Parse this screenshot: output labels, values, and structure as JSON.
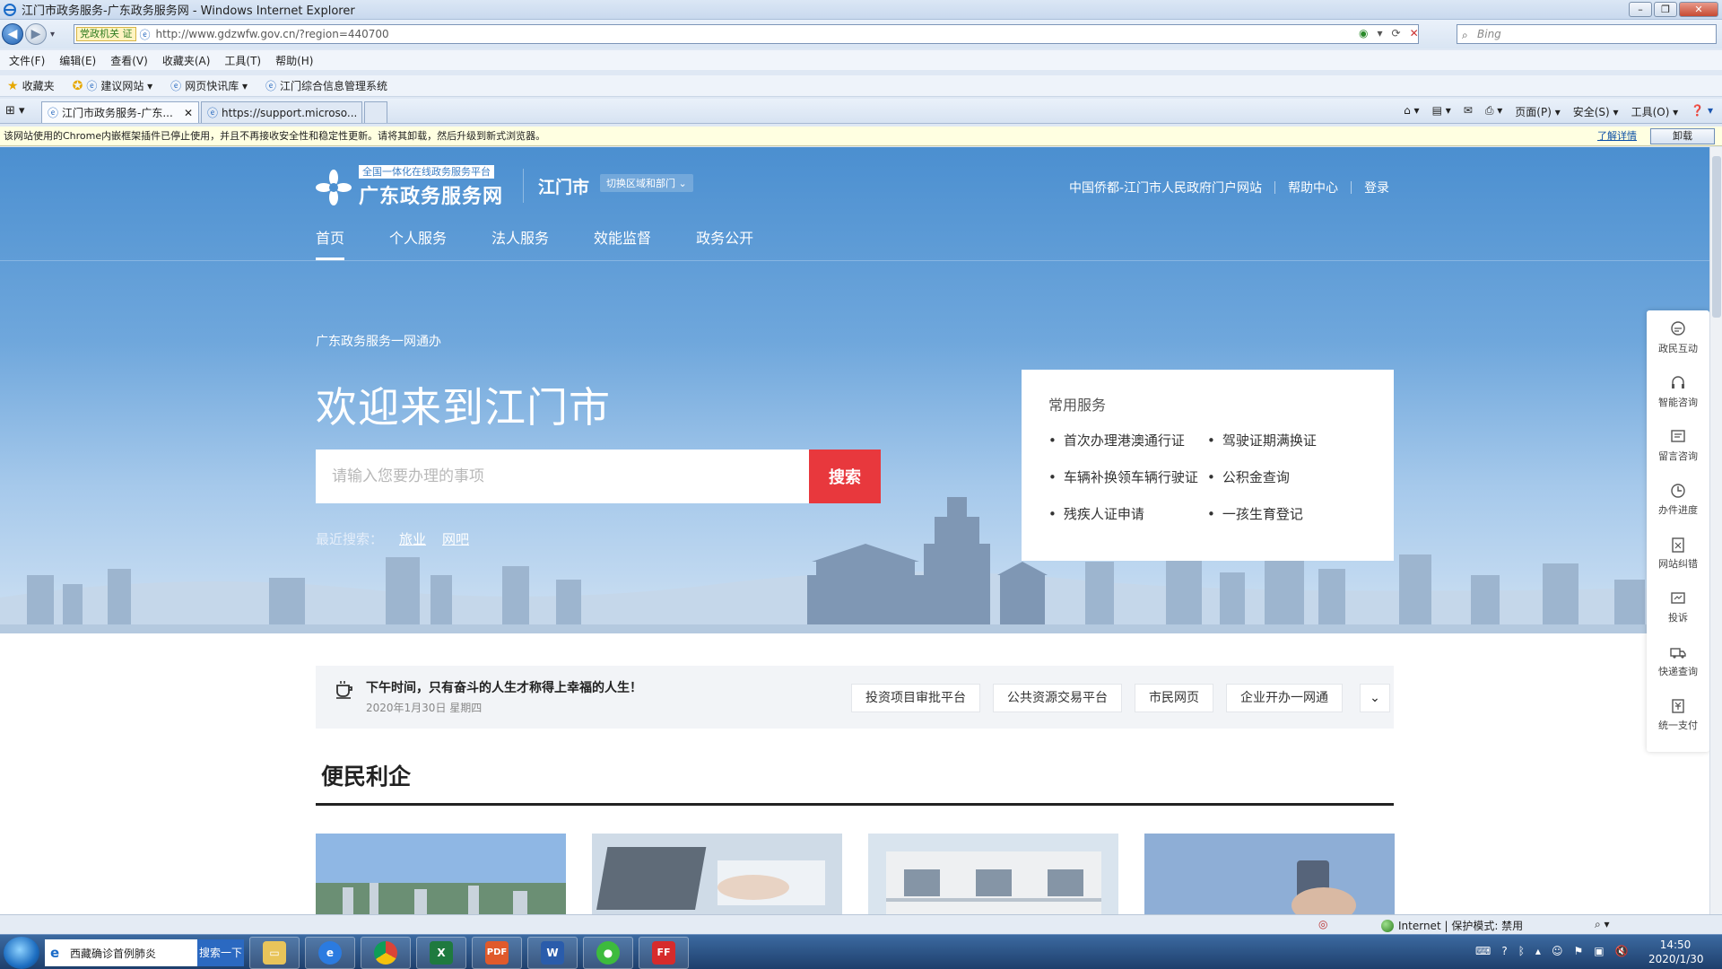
{
  "window": {
    "title": "江门市政务服务-广东政务服务网 - Windows Internet Explorer",
    "address": "http://www.gdzwfw.gov.cn/?region=440700",
    "address_badge": "党政机关 证",
    "search_placeholder": "Bing"
  },
  "menu": [
    "文件(F)",
    "编辑(E)",
    "查看(V)",
    "收藏夹(A)",
    "工具(T)",
    "帮助(H)"
  ],
  "favorites": {
    "label": "收藏夹",
    "items": [
      "建议网站 ▾",
      "网页快讯库 ▾",
      "江门综合信息管理系统"
    ]
  },
  "tabs": [
    {
      "label": "江门市政务服务-广东..."
    },
    {
      "label": "https://support.microso..."
    }
  ],
  "toolbar_tools": [
    "页面(P) ▾",
    "安全(S) ▾",
    "工具(O) ▾"
  ],
  "infobar": {
    "message": "该网站使用的Chrome内嵌框架插件已停止使用，并且不再接收安全性和稳定性更新。请将其卸载，然后升级到新式浏览器。",
    "more": "了解详情",
    "uninstall": "卸载"
  },
  "site": {
    "logo_tag": "全国一体化在线政务服务平台",
    "logo_name": "广东政务服务网",
    "city": "江门市",
    "switch_label": "切换区域和部门 ⌄",
    "top_links": [
      "中国侨都-江门市人民政府门户网站",
      "帮助中心",
      "登录"
    ],
    "nav": [
      "首页",
      "个人服务",
      "法人服务",
      "效能监督",
      "政务公开"
    ],
    "slogan": "广东政务服务一网通办",
    "welcome": "欢迎来到江门市",
    "search_placeholder": "请输入您要办理的事项",
    "search_button": "搜索",
    "recent_label": "最近搜索：",
    "recent_items": [
      "旅业",
      "网吧"
    ],
    "common_title": "常用服务",
    "common_items": [
      "首次办理港澳通行证",
      "驾驶证期满换证",
      "车辆补换领车辆行驶证",
      "公积金查询",
      "残疾人证申请",
      "一孩生育登记"
    ],
    "strip_message": "下午时间，只有奋斗的人生才称得上幸福的人生！",
    "strip_date": "2020年1月30日 星期四",
    "strip_links": [
      "投资项目审批平台",
      "公共资源交易平台",
      "市民网页",
      "企业开办一网通"
    ],
    "section_title": "便民利企",
    "side_items": [
      "政民互动",
      "智能咨询",
      "留言咨询",
      "办件进度",
      "网站纠错",
      "投诉",
      "快递查询",
      "统一支付"
    ]
  },
  "statusbar": {
    "zone": "Internet | 保护模式: 禁用"
  },
  "taskbar": {
    "search_text": "西藏确诊首例肺炎",
    "search_button": "搜索一下",
    "time": "14:50",
    "date": "2020/1/30"
  }
}
